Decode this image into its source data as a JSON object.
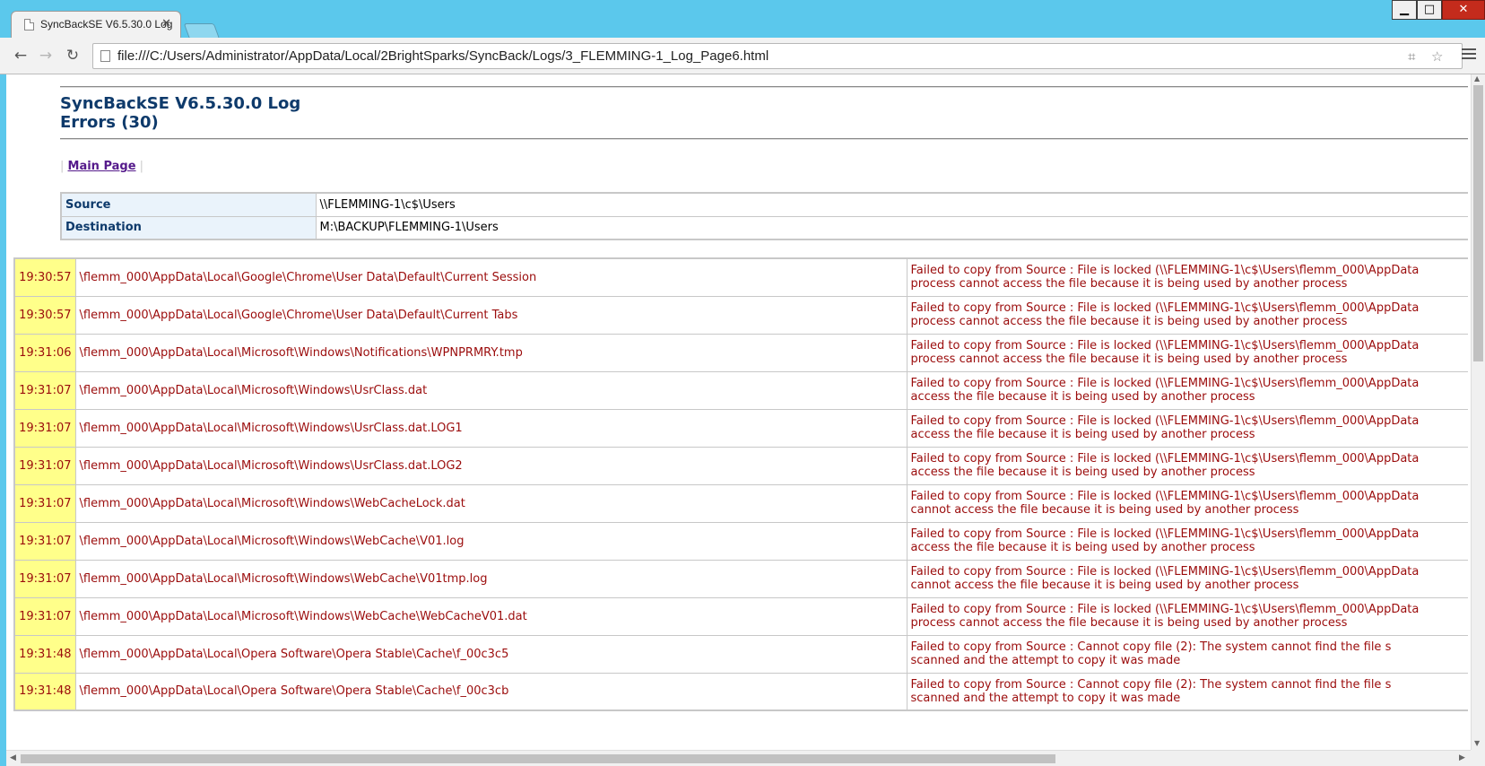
{
  "tab": {
    "title": "SyncBackSE V6.5.30.0 Log",
    "close": "✕"
  },
  "window": {
    "minimize": "▁",
    "maximize": "□",
    "close": "✕"
  },
  "toolbar": {
    "back": "←",
    "forward": "→",
    "reload": "↻",
    "url": "file:///C:/Users/Administrator/AppData/Local/2BrightSparks/SyncBack/Logs/3_FLEMMING-1_Log_Page6.html",
    "translate": "⌗",
    "bookmark": "☆"
  },
  "page": {
    "title": "SyncBackSE V6.5.30.0 Log",
    "errors_heading": "Errors (30)",
    "nav_link": "Main Page",
    "summary": [
      {
        "label": "Source",
        "value": "\\\\FLEMMING-1\\c$\\Users"
      },
      {
        "label": "Destination",
        "value": "M:\\BACKUP\\FLEMMING-1\\Users"
      }
    ],
    "errors": [
      {
        "time": "19:30:57",
        "file": "\\flemm_000\\AppData\\Local\\Google\\Chrome\\User Data\\Default\\Current Session",
        "msg1": "Failed to copy from Source : File is locked (\\\\FLEMMING-1\\c$\\Users\\flemm_000\\AppData",
        "msg2": "process cannot access the file because it is being used by another process"
      },
      {
        "time": "19:30:57",
        "file": "\\flemm_000\\AppData\\Local\\Google\\Chrome\\User Data\\Default\\Current Tabs",
        "msg1": "Failed to copy from Source : File is locked (\\\\FLEMMING-1\\c$\\Users\\flemm_000\\AppData",
        "msg2": "process cannot access the file because it is being used by another process"
      },
      {
        "time": "19:31:06",
        "file": "\\flemm_000\\AppData\\Local\\Microsoft\\Windows\\Notifications\\WPNPRMRY.tmp",
        "msg1": "Failed to copy from Source : File is locked (\\\\FLEMMING-1\\c$\\Users\\flemm_000\\AppData",
        "msg2": "process cannot access the file because it is being used by another process"
      },
      {
        "time": "19:31:07",
        "file": "\\flemm_000\\AppData\\Local\\Microsoft\\Windows\\UsrClass.dat",
        "msg1": "Failed to copy from Source : File is locked (\\\\FLEMMING-1\\c$\\Users\\flemm_000\\AppData",
        "msg2": "access the file because it is being used by another process"
      },
      {
        "time": "19:31:07",
        "file": "\\flemm_000\\AppData\\Local\\Microsoft\\Windows\\UsrClass.dat.LOG1",
        "msg1": "Failed to copy from Source : File is locked (\\\\FLEMMING-1\\c$\\Users\\flemm_000\\AppData",
        "msg2": "access the file because it is being used by another process"
      },
      {
        "time": "19:31:07",
        "file": "\\flemm_000\\AppData\\Local\\Microsoft\\Windows\\UsrClass.dat.LOG2",
        "msg1": "Failed to copy from Source : File is locked (\\\\FLEMMING-1\\c$\\Users\\flemm_000\\AppData",
        "msg2": "access the file because it is being used by another process"
      },
      {
        "time": "19:31:07",
        "file": "\\flemm_000\\AppData\\Local\\Microsoft\\Windows\\WebCacheLock.dat",
        "msg1": "Failed to copy from Source : File is locked (\\\\FLEMMING-1\\c$\\Users\\flemm_000\\AppData",
        "msg2": "cannot access the file because it is being used by another process"
      },
      {
        "time": "19:31:07",
        "file": "\\flemm_000\\AppData\\Local\\Microsoft\\Windows\\WebCache\\V01.log",
        "msg1": "Failed to copy from Source : File is locked (\\\\FLEMMING-1\\c$\\Users\\flemm_000\\AppData",
        "msg2": "access the file because it is being used by another process"
      },
      {
        "time": "19:31:07",
        "file": "\\flemm_000\\AppData\\Local\\Microsoft\\Windows\\WebCache\\V01tmp.log",
        "msg1": "Failed to copy from Source : File is locked (\\\\FLEMMING-1\\c$\\Users\\flemm_000\\AppData",
        "msg2": "cannot access the file because it is being used by another process"
      },
      {
        "time": "19:31:07",
        "file": "\\flemm_000\\AppData\\Local\\Microsoft\\Windows\\WebCache\\WebCacheV01.dat",
        "msg1": "Failed to copy from Source : File is locked (\\\\FLEMMING-1\\c$\\Users\\flemm_000\\AppData",
        "msg2": "process cannot access the file because it is being used by another process"
      },
      {
        "time": "19:31:48",
        "file": "\\flemm_000\\AppData\\Local\\Opera Software\\Opera Stable\\Cache\\f_00c3c5",
        "msg1": "Failed to copy from Source : Cannot copy file (2): The system cannot find the file s",
        "msg2": "scanned and the attempt to copy it was made"
      },
      {
        "time": "19:31:48",
        "file": "\\flemm_000\\AppData\\Local\\Opera Software\\Opera Stable\\Cache\\f_00c3cb",
        "msg1": "Failed to copy from Source : Cannot copy file (2): The system cannot find the file s",
        "msg2": "scanned and the attempt to copy it was made"
      }
    ]
  }
}
